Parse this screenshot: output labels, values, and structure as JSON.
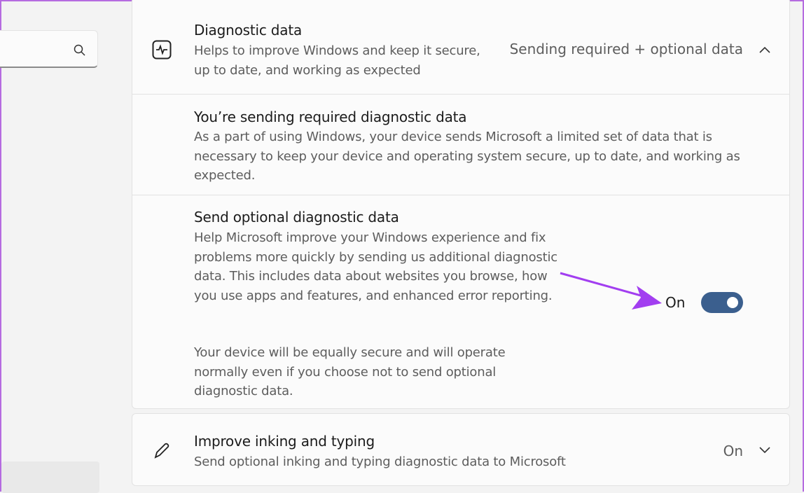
{
  "sidebar": {
    "search_icon": "search-icon"
  },
  "diagnostic": {
    "icon": "activity-icon",
    "title": "Diagnostic data",
    "desc": "Helps to improve Windows and keep it secure, up to date, and working as expected",
    "status": "Sending required + optional data",
    "chevron": "chevron-up-icon"
  },
  "required": {
    "title": "You’re sending required diagnostic data",
    "desc": "As a part of using Windows, your device sends Microsoft a limited set of data that is necessary to keep your device and operating system secure, up to date, and working as expected."
  },
  "optional": {
    "title": "Send optional diagnostic data",
    "desc": "Help Microsoft improve your Windows experience and fix problems more quickly by sending us additional diagnostic data. This includes data about websites you browse, how you use apps and features, and enhanced error reporting.",
    "note": "Your device will be equally secure and will operate normally even if you choose not to send optional diagnostic data.",
    "toggle_label": "On",
    "toggle_on": true,
    "toggle_color": "#3b5f8e",
    "annotation_color": "#a23ef0"
  },
  "inking": {
    "icon": "pen-icon",
    "title": "Improve inking and typing",
    "desc": "Send optional inking and typing diagnostic data to Microsoft",
    "status": "On",
    "chevron": "chevron-down-icon"
  }
}
